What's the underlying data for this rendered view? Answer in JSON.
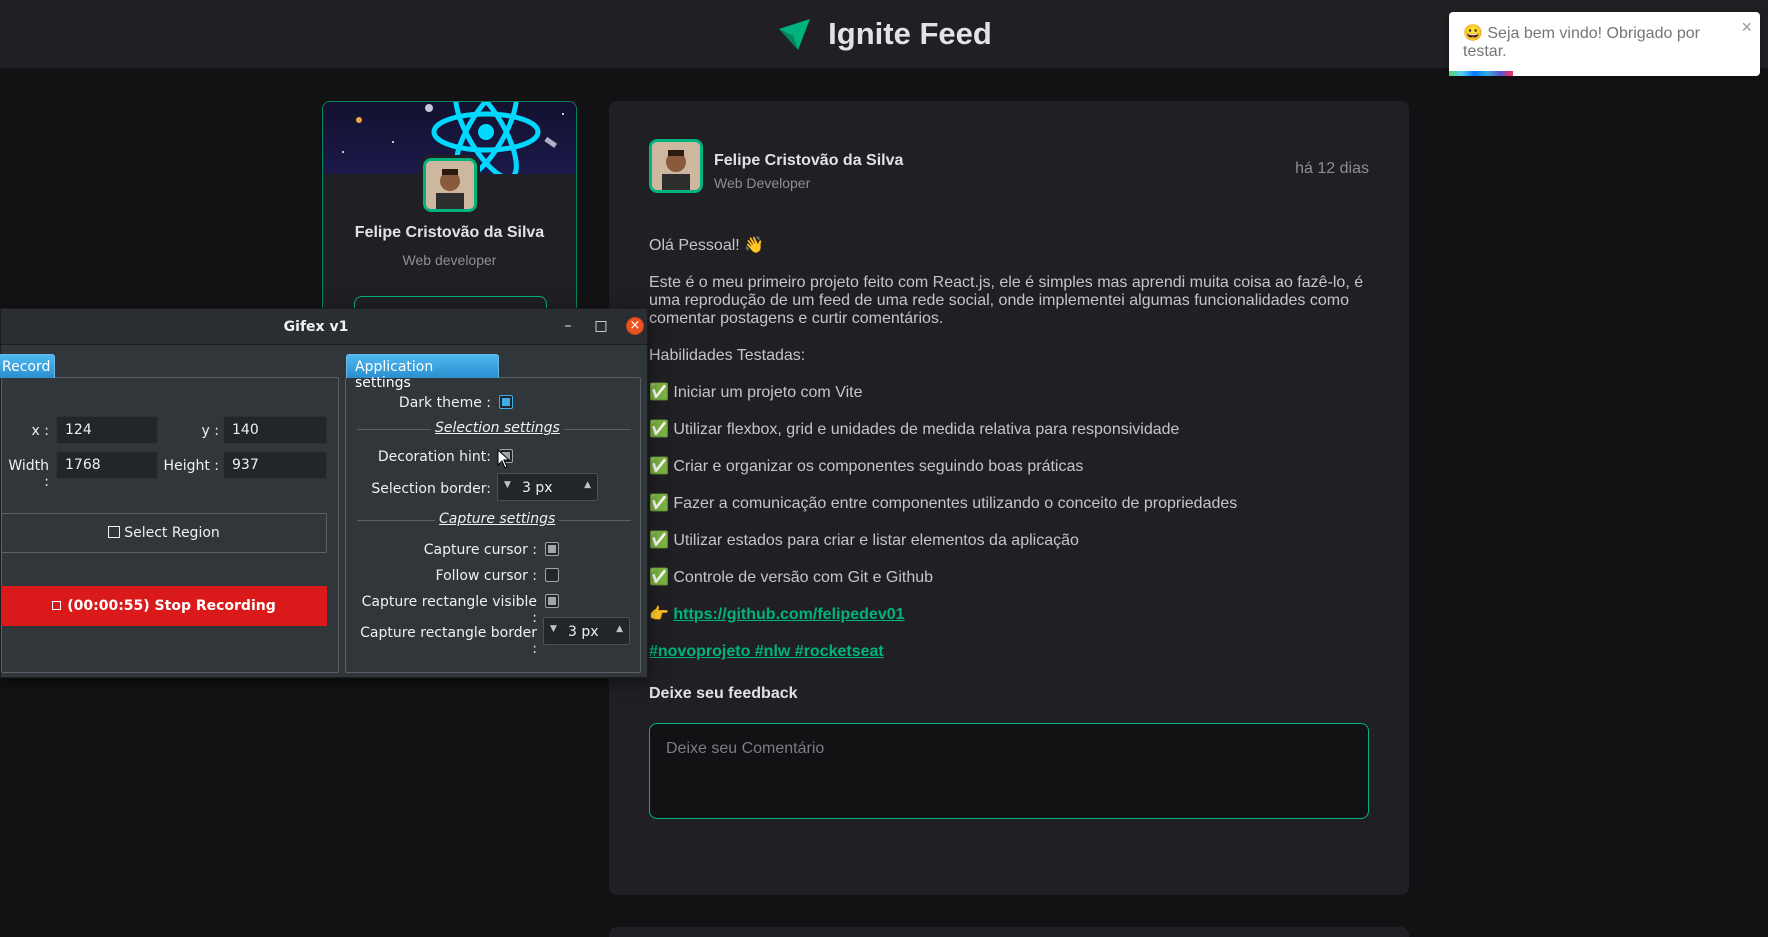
{
  "header": {
    "title": "Ignite Feed",
    "logo_icon": "paper-plane-icon"
  },
  "toast": {
    "message": "😀 Seja bem vindo! Obrigado por testar.",
    "close": "×"
  },
  "profile": {
    "name": "Felipe Cristovão da Silva",
    "role": "Web developer"
  },
  "post": {
    "author": "Felipe Cristovão da Silva",
    "role": "Web Developer",
    "time": "há 12 dias",
    "greeting": "Olá Pessoal! 👋",
    "intro": "Este é o meu primeiro projeto feito com React.js, ele é simples mas aprendi muita coisa ao fazê-lo, é uma reprodução de um feed de uma rede social, onde implementei algumas funcionalidades como comentar postagens e curtir comentários.",
    "skills_title": "Habilidades Testadas:",
    "skills": [
      "✅ Iniciar um projeto com Vite",
      "✅ Utilizar flexbox, grid e unidades de medida relativa para responsividade",
      "✅ Criar e organizar os componentes seguindo boas práticas",
      "✅ Fazer a comunicação entre componentes utilizando o conceito de propriedades",
      "✅ Utilizar estados para criar e listar elementos da aplicação",
      "✅ Controle de versão com Git e Github"
    ],
    "link_prefix": "👉 ",
    "link": "https://github.com/felipedev01",
    "hashtags": "#novoprojeto #nlw #rocketseat",
    "feedback_title": "Deixe seu feedback",
    "comment_placeholder": "Deixe seu Comentário"
  },
  "gifex": {
    "title": "Gifex v1",
    "record_tab": "Record",
    "x_label": "x :",
    "x_value": "124",
    "y_label": "y :",
    "y_value": "140",
    "width_label": "Width :",
    "width_value": "1768",
    "height_label": "Height :",
    "height_value": "937",
    "select_region": "Select Region",
    "stop_recording": "(00:00:55) Stop Recording",
    "app_tab": "Application settings",
    "dark_theme": "Dark theme :",
    "selection_settings": "Selection settings",
    "decoration_hint": "Decoration hint:",
    "selection_border": "Selection border:",
    "selection_border_value": "3 px",
    "capture_settings": "Capture settings",
    "capture_cursor": "Capture cursor :",
    "follow_cursor": "Follow cursor :",
    "capture_rect_visible": "Capture rectangle visible :",
    "capture_rect_border": "Capture rectangle border :",
    "capture_rect_border_value": "3 px",
    "minimize": "–",
    "maximize": "□",
    "close": "×"
  }
}
